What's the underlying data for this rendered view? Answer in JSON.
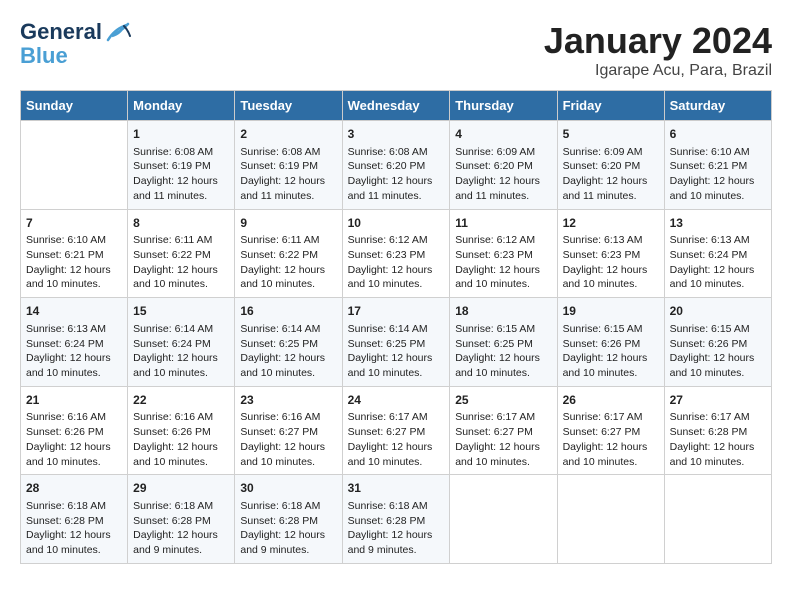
{
  "header": {
    "logo_line1": "General",
    "logo_line2": "Blue",
    "month": "January 2024",
    "location": "Igarape Acu, Para, Brazil"
  },
  "days_of_week": [
    "Sunday",
    "Monday",
    "Tuesday",
    "Wednesday",
    "Thursday",
    "Friday",
    "Saturday"
  ],
  "weeks": [
    [
      {
        "day": "",
        "sunrise": "",
        "sunset": "",
        "daylight": ""
      },
      {
        "day": "1",
        "sunrise": "Sunrise: 6:08 AM",
        "sunset": "Sunset: 6:19 PM",
        "daylight": "Daylight: 12 hours and 11 minutes."
      },
      {
        "day": "2",
        "sunrise": "Sunrise: 6:08 AM",
        "sunset": "Sunset: 6:19 PM",
        "daylight": "Daylight: 12 hours and 11 minutes."
      },
      {
        "day": "3",
        "sunrise": "Sunrise: 6:08 AM",
        "sunset": "Sunset: 6:20 PM",
        "daylight": "Daylight: 12 hours and 11 minutes."
      },
      {
        "day": "4",
        "sunrise": "Sunrise: 6:09 AM",
        "sunset": "Sunset: 6:20 PM",
        "daylight": "Daylight: 12 hours and 11 minutes."
      },
      {
        "day": "5",
        "sunrise": "Sunrise: 6:09 AM",
        "sunset": "Sunset: 6:20 PM",
        "daylight": "Daylight: 12 hours and 11 minutes."
      },
      {
        "day": "6",
        "sunrise": "Sunrise: 6:10 AM",
        "sunset": "Sunset: 6:21 PM",
        "daylight": "Daylight: 12 hours and 10 minutes."
      }
    ],
    [
      {
        "day": "7",
        "sunrise": "Sunrise: 6:10 AM",
        "sunset": "Sunset: 6:21 PM",
        "daylight": "Daylight: 12 hours and 10 minutes."
      },
      {
        "day": "8",
        "sunrise": "Sunrise: 6:11 AM",
        "sunset": "Sunset: 6:22 PM",
        "daylight": "Daylight: 12 hours and 10 minutes."
      },
      {
        "day": "9",
        "sunrise": "Sunrise: 6:11 AM",
        "sunset": "Sunset: 6:22 PM",
        "daylight": "Daylight: 12 hours and 10 minutes."
      },
      {
        "day": "10",
        "sunrise": "Sunrise: 6:12 AM",
        "sunset": "Sunset: 6:23 PM",
        "daylight": "Daylight: 12 hours and 10 minutes."
      },
      {
        "day": "11",
        "sunrise": "Sunrise: 6:12 AM",
        "sunset": "Sunset: 6:23 PM",
        "daylight": "Daylight: 12 hours and 10 minutes."
      },
      {
        "day": "12",
        "sunrise": "Sunrise: 6:13 AM",
        "sunset": "Sunset: 6:23 PM",
        "daylight": "Daylight: 12 hours and 10 minutes."
      },
      {
        "day": "13",
        "sunrise": "Sunrise: 6:13 AM",
        "sunset": "Sunset: 6:24 PM",
        "daylight": "Daylight: 12 hours and 10 minutes."
      }
    ],
    [
      {
        "day": "14",
        "sunrise": "Sunrise: 6:13 AM",
        "sunset": "Sunset: 6:24 PM",
        "daylight": "Daylight: 12 hours and 10 minutes."
      },
      {
        "day": "15",
        "sunrise": "Sunrise: 6:14 AM",
        "sunset": "Sunset: 6:24 PM",
        "daylight": "Daylight: 12 hours and 10 minutes."
      },
      {
        "day": "16",
        "sunrise": "Sunrise: 6:14 AM",
        "sunset": "Sunset: 6:25 PM",
        "daylight": "Daylight: 12 hours and 10 minutes."
      },
      {
        "day": "17",
        "sunrise": "Sunrise: 6:14 AM",
        "sunset": "Sunset: 6:25 PM",
        "daylight": "Daylight: 12 hours and 10 minutes."
      },
      {
        "day": "18",
        "sunrise": "Sunrise: 6:15 AM",
        "sunset": "Sunset: 6:25 PM",
        "daylight": "Daylight: 12 hours and 10 minutes."
      },
      {
        "day": "19",
        "sunrise": "Sunrise: 6:15 AM",
        "sunset": "Sunset: 6:26 PM",
        "daylight": "Daylight: 12 hours and 10 minutes."
      },
      {
        "day": "20",
        "sunrise": "Sunrise: 6:15 AM",
        "sunset": "Sunset: 6:26 PM",
        "daylight": "Daylight: 12 hours and 10 minutes."
      }
    ],
    [
      {
        "day": "21",
        "sunrise": "Sunrise: 6:16 AM",
        "sunset": "Sunset: 6:26 PM",
        "daylight": "Daylight: 12 hours and 10 minutes."
      },
      {
        "day": "22",
        "sunrise": "Sunrise: 6:16 AM",
        "sunset": "Sunset: 6:26 PM",
        "daylight": "Daylight: 12 hours and 10 minutes."
      },
      {
        "day": "23",
        "sunrise": "Sunrise: 6:16 AM",
        "sunset": "Sunset: 6:27 PM",
        "daylight": "Daylight: 12 hours and 10 minutes."
      },
      {
        "day": "24",
        "sunrise": "Sunrise: 6:17 AM",
        "sunset": "Sunset: 6:27 PM",
        "daylight": "Daylight: 12 hours and 10 minutes."
      },
      {
        "day": "25",
        "sunrise": "Sunrise: 6:17 AM",
        "sunset": "Sunset: 6:27 PM",
        "daylight": "Daylight: 12 hours and 10 minutes."
      },
      {
        "day": "26",
        "sunrise": "Sunrise: 6:17 AM",
        "sunset": "Sunset: 6:27 PM",
        "daylight": "Daylight: 12 hours and 10 minutes."
      },
      {
        "day": "27",
        "sunrise": "Sunrise: 6:17 AM",
        "sunset": "Sunset: 6:28 PM",
        "daylight": "Daylight: 12 hours and 10 minutes."
      }
    ],
    [
      {
        "day": "28",
        "sunrise": "Sunrise: 6:18 AM",
        "sunset": "Sunset: 6:28 PM",
        "daylight": "Daylight: 12 hours and 10 minutes."
      },
      {
        "day": "29",
        "sunrise": "Sunrise: 6:18 AM",
        "sunset": "Sunset: 6:28 PM",
        "daylight": "Daylight: 12 hours and 9 minutes."
      },
      {
        "day": "30",
        "sunrise": "Sunrise: 6:18 AM",
        "sunset": "Sunset: 6:28 PM",
        "daylight": "Daylight: 12 hours and 9 minutes."
      },
      {
        "day": "31",
        "sunrise": "Sunrise: 6:18 AM",
        "sunset": "Sunset: 6:28 PM",
        "daylight": "Daylight: 12 hours and 9 minutes."
      },
      {
        "day": "",
        "sunrise": "",
        "sunset": "",
        "daylight": ""
      },
      {
        "day": "",
        "sunrise": "",
        "sunset": "",
        "daylight": ""
      },
      {
        "day": "",
        "sunrise": "",
        "sunset": "",
        "daylight": ""
      }
    ]
  ]
}
